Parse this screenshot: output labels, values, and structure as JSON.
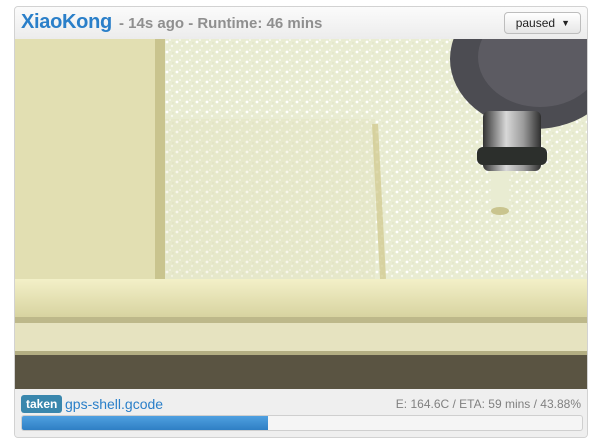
{
  "header": {
    "printer_name": "XiaoKong",
    "meta": "- 14s ago - Runtime: 46 mins",
    "status_dropdown": "paused"
  },
  "camera": {
    "feed": "webcam view of CNC print bed"
  },
  "footer": {
    "badge": "taken",
    "filename": "gps-shell.gcode",
    "stats": "E: 164.6C / ETA: 59 mins / 43.88%",
    "progress_percent": 43.88
  },
  "colors": {
    "accent": "#2a7fc9",
    "badge": "#3a87ad",
    "muted_text": "#8f8f8f"
  }
}
